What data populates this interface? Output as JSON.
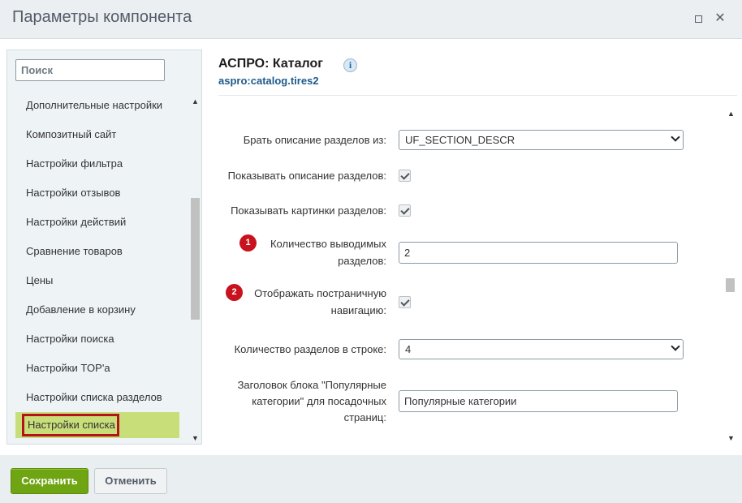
{
  "window": {
    "title": "Параметры компонента",
    "maximize_icon": "maximize-icon",
    "close_icon": "close-icon"
  },
  "sidebar": {
    "search_placeholder": "Поиск",
    "items": [
      {
        "label": "Дополнительные настройки"
      },
      {
        "label": "Композитный сайт"
      },
      {
        "label": "Настройки фильтра"
      },
      {
        "label": "Настройки отзывов"
      },
      {
        "label": "Настройки действий"
      },
      {
        "label": "Сравнение товаров"
      },
      {
        "label": "Цены"
      },
      {
        "label": "Добавление в корзину"
      },
      {
        "label": "Настройки поиска"
      },
      {
        "label": "Настройки TOP'a"
      },
      {
        "label": "Настройки списка разделов"
      },
      {
        "label": "Настройки списка",
        "active": true
      }
    ]
  },
  "component": {
    "title": "АСПРО: Каталог",
    "info_icon": "i",
    "code": "aspro:catalog.tires2"
  },
  "form": {
    "section_descr_label": "Брать описание разделов из:",
    "section_descr_value": "UF_SECTION_DESCR",
    "show_section_descr_label": "Показывать описание разделов:",
    "show_section_descr_checked": true,
    "show_section_pics_label": "Показывать картинки разделов:",
    "show_section_pics_checked": true,
    "sections_count_badge": "1",
    "sections_count_label_1": "Количество выводимых",
    "sections_count_label_2": "разделов:",
    "sections_count_value": "2",
    "pager_badge": "2",
    "pager_label_1": "Отображать постраничную",
    "pager_label_2": "навигацию:",
    "pager_checked": true,
    "per_row_label": "Количество разделов в строке:",
    "per_row_value": "4",
    "popular_title_label_1": "Заголовок блока \"Популярные",
    "popular_title_label_2": "категории\" для посадочных",
    "popular_title_label_3": "страниц:",
    "popular_title_value": "Популярные категории"
  },
  "colors": {
    "save_green": "#6fa413",
    "active_item": "#c8df79",
    "badge_red": "#c8121e",
    "link_blue": "#1e5a8c"
  },
  "footer": {
    "save_label": "Сохранить",
    "cancel_label": "Отменить"
  }
}
